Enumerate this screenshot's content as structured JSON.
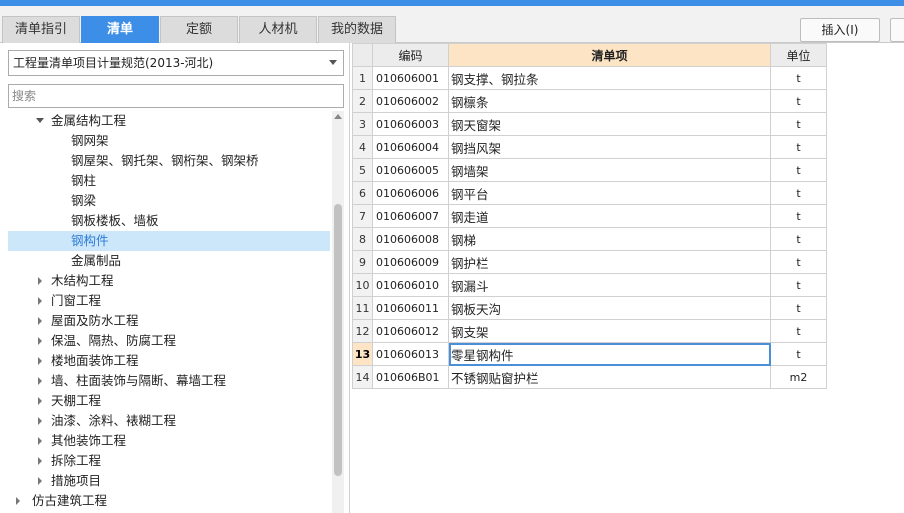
{
  "tabs": [
    {
      "label": "清单指引",
      "active": false
    },
    {
      "label": "清单",
      "active": true
    },
    {
      "label": "定额",
      "active": false
    },
    {
      "label": "人材机",
      "active": false
    },
    {
      "label": "我的数据",
      "active": false
    }
  ],
  "toolbar": {
    "insert_label": "插入(I)"
  },
  "library_select": {
    "value": "工程量清单项目计量规范(2013-河北)"
  },
  "search": {
    "placeholder": "搜索"
  },
  "tree": [
    {
      "label": "金属结构工程",
      "expander": "expanded"
    },
    {
      "label": "钢网架",
      "expander": "none"
    },
    {
      "label": "钢屋架、钢托架、钢桁架、钢架桥",
      "expander": "none"
    },
    {
      "label": "钢柱",
      "expander": "none"
    },
    {
      "label": "钢梁",
      "expander": "none"
    },
    {
      "label": "钢板楼板、墙板",
      "expander": "none"
    },
    {
      "label": "钢构件",
      "expander": "none",
      "selected": true
    },
    {
      "label": "金属制品",
      "expander": "none"
    },
    {
      "label": "木结构工程",
      "expander": "collapsed"
    },
    {
      "label": "门窗工程",
      "expander": "collapsed"
    },
    {
      "label": "屋面及防水工程",
      "expander": "collapsed"
    },
    {
      "label": "保温、隔热、防腐工程",
      "expander": "collapsed"
    },
    {
      "label": "楼地面装饰工程",
      "expander": "collapsed"
    },
    {
      "label": "墙、柱面装饰与隔断、幕墙工程",
      "expander": "collapsed"
    },
    {
      "label": "天棚工程",
      "expander": "collapsed"
    },
    {
      "label": "油漆、涂料、裱糊工程",
      "expander": "collapsed"
    },
    {
      "label": "其他装饰工程",
      "expander": "collapsed"
    },
    {
      "label": "拆除工程",
      "expander": "collapsed"
    },
    {
      "label": "措施项目",
      "expander": "collapsed"
    },
    {
      "label": "仿古建筑工程",
      "expander": "collapsed"
    }
  ],
  "grid": {
    "headers": {
      "code": "编码",
      "name": "清单项",
      "unit": "单位"
    },
    "current_row": 13,
    "rows": [
      {
        "num": "1",
        "code": "010606001",
        "name": "钢支撑、钢拉条",
        "unit": "t"
      },
      {
        "num": "2",
        "code": "010606002",
        "name": "钢檩条",
        "unit": "t"
      },
      {
        "num": "3",
        "code": "010606003",
        "name": "钢天窗架",
        "unit": "t"
      },
      {
        "num": "4",
        "code": "010606004",
        "name": "钢挡风架",
        "unit": "t"
      },
      {
        "num": "5",
        "code": "010606005",
        "name": "钢墙架",
        "unit": "t"
      },
      {
        "num": "6",
        "code": "010606006",
        "name": "钢平台",
        "unit": "t"
      },
      {
        "num": "7",
        "code": "010606007",
        "name": "钢走道",
        "unit": "t"
      },
      {
        "num": "8",
        "code": "010606008",
        "name": "钢梯",
        "unit": "t"
      },
      {
        "num": "9",
        "code": "010606009",
        "name": "钢护栏",
        "unit": "t"
      },
      {
        "num": "10",
        "code": "010606010",
        "name": "钢漏斗",
        "unit": "t"
      },
      {
        "num": "11",
        "code": "010606011",
        "name": "钢板天沟",
        "unit": "t"
      },
      {
        "num": "12",
        "code": "010606012",
        "name": "钢支架",
        "unit": "t"
      },
      {
        "num": "13",
        "code": "010606013",
        "name": "零星钢构件",
        "unit": "t"
      },
      {
        "num": "14",
        "code": "010606B01",
        "name": "不锈钢贴窗护栏",
        "unit": "m2"
      }
    ]
  }
}
